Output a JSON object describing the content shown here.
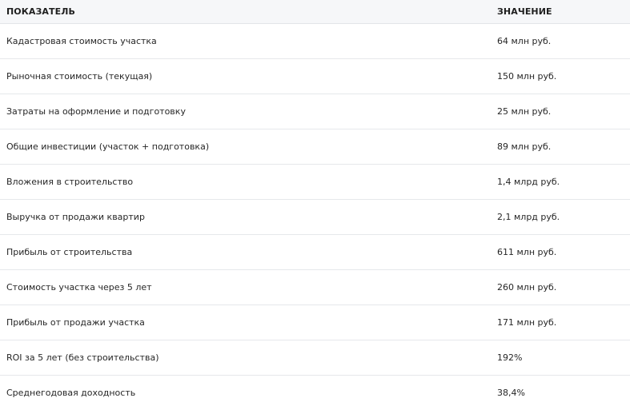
{
  "table": {
    "headers": {
      "indicator": "ПОКАЗАТЕЛЬ",
      "value": "ЗНАЧЕНИЕ"
    },
    "rows": [
      {
        "indicator": "Кадастровая стоимость участка",
        "value": "64 млн руб."
      },
      {
        "indicator": "Рыночная стоимость (текущая)",
        "value": "150 млн руб."
      },
      {
        "indicator": "Затраты на оформление и подготовку",
        "value": "25 млн руб."
      },
      {
        "indicator": "Общие инвестиции (участок + подготовка)",
        "value": "89 млн руб."
      },
      {
        "indicator": "Вложения в строительство",
        "value": "1,4 млрд руб."
      },
      {
        "indicator": "Выручка от продажи квартир",
        "value": "2,1 млрд руб."
      },
      {
        "indicator": "Прибыль от строительства",
        "value": "611 млн руб."
      },
      {
        "indicator": "Стоимость участка через 5 лет",
        "value": "260 млн руб."
      },
      {
        "indicator": "Прибыль от продажи участка",
        "value": "171 млн руб."
      },
      {
        "indicator": "ROI за 5 лет (без строительства)",
        "value": "192%"
      },
      {
        "indicator": "Среднегодовая доходность",
        "value": "38,4%"
      }
    ]
  }
}
